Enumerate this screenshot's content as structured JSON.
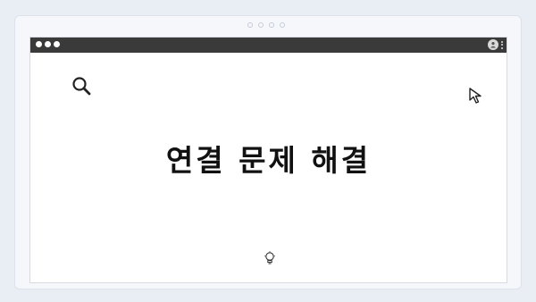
{
  "header": {
    "page_indicator_count": 4
  },
  "window": {
    "title_bar": {
      "controls": [
        "dot",
        "dot",
        "dot"
      ],
      "right_icons": [
        "profile-icon",
        "kebab-menu-icon"
      ]
    }
  },
  "main": {
    "heading": "연결 문제 해결",
    "icons": [
      "search-icon",
      "cursor-arrow-icon",
      "lightbulb-icon"
    ]
  },
  "colors": {
    "background": "#e9edf4",
    "title_bar": "#3a3a3a",
    "window": "#ffffff",
    "text": "#111111"
  }
}
